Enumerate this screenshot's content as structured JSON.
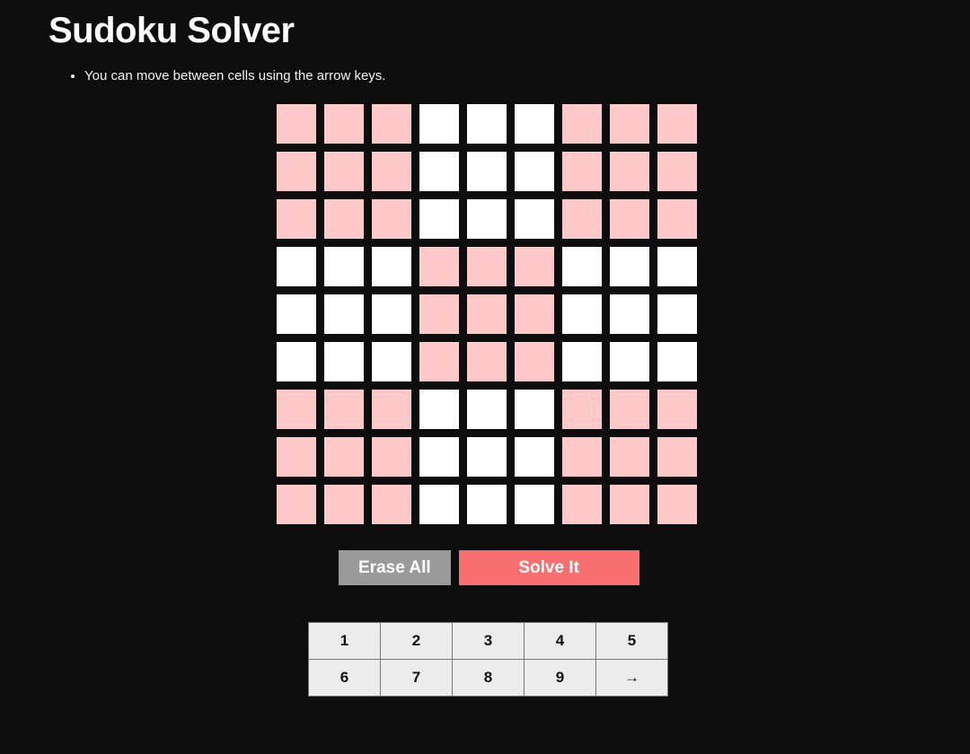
{
  "page": {
    "title": "Sudoku Solver",
    "background_color": "#0d0d0d"
  },
  "hints": [
    {
      "text": "You can move between cells using the arrow keys."
    }
  ],
  "board": {
    "rows": 9,
    "cols": 9,
    "shaded_color": "#ffc9c9",
    "empty_color": "#ffffff",
    "values": [
      [
        "",
        "",
        "",
        "",
        "",
        "",
        "",
        "",
        ""
      ],
      [
        "",
        "",
        "",
        "",
        "",
        "",
        "",
        "",
        ""
      ],
      [
        "",
        "",
        "",
        "",
        "",
        "",
        "",
        "",
        ""
      ],
      [
        "",
        "",
        "",
        "",
        "",
        "",
        "",
        "",
        ""
      ],
      [
        "",
        "",
        "",
        "",
        "",
        "",
        "",
        "",
        ""
      ],
      [
        "",
        "",
        "",
        "",
        "",
        "",
        "",
        "",
        ""
      ],
      [
        "",
        "",
        "",
        "",
        "",
        "",
        "",
        "",
        ""
      ],
      [
        "",
        "",
        "",
        "",
        "",
        "",
        "",
        "",
        ""
      ],
      [
        "",
        "",
        "",
        "",
        "",
        "",
        "",
        "",
        ""
      ]
    ],
    "shading": [
      [
        1,
        1,
        1,
        0,
        0,
        0,
        1,
        1,
        1
      ],
      [
        1,
        1,
        1,
        0,
        0,
        0,
        1,
        1,
        1
      ],
      [
        1,
        1,
        1,
        0,
        0,
        0,
        1,
        1,
        1
      ],
      [
        0,
        0,
        0,
        1,
        1,
        1,
        0,
        0,
        0
      ],
      [
        0,
        0,
        0,
        1,
        1,
        1,
        0,
        0,
        0
      ],
      [
        0,
        0,
        0,
        1,
        1,
        1,
        0,
        0,
        0
      ],
      [
        1,
        1,
        1,
        0,
        0,
        0,
        1,
        1,
        1
      ],
      [
        1,
        1,
        1,
        0,
        0,
        0,
        1,
        1,
        1
      ],
      [
        1,
        1,
        1,
        0,
        0,
        0,
        1,
        1,
        1
      ]
    ]
  },
  "actions": {
    "erase_label": "Erase All",
    "erase_color": "#9a9a9a",
    "solve_label": "Solve It",
    "solve_color": "#f96e6e"
  },
  "keypad": {
    "background_color": "#ececec",
    "border_color": "#777777",
    "keys": [
      {
        "label": "1",
        "name": "key-1"
      },
      {
        "label": "2",
        "name": "key-2"
      },
      {
        "label": "3",
        "name": "key-3"
      },
      {
        "label": "4",
        "name": "key-4"
      },
      {
        "label": "5",
        "name": "key-5"
      },
      {
        "label": "6",
        "name": "key-6"
      },
      {
        "label": "7",
        "name": "key-7"
      },
      {
        "label": "8",
        "name": "key-8"
      },
      {
        "label": "9",
        "name": "key-9"
      },
      {
        "label": "→",
        "name": "key-next-arrow-icon"
      }
    ]
  }
}
